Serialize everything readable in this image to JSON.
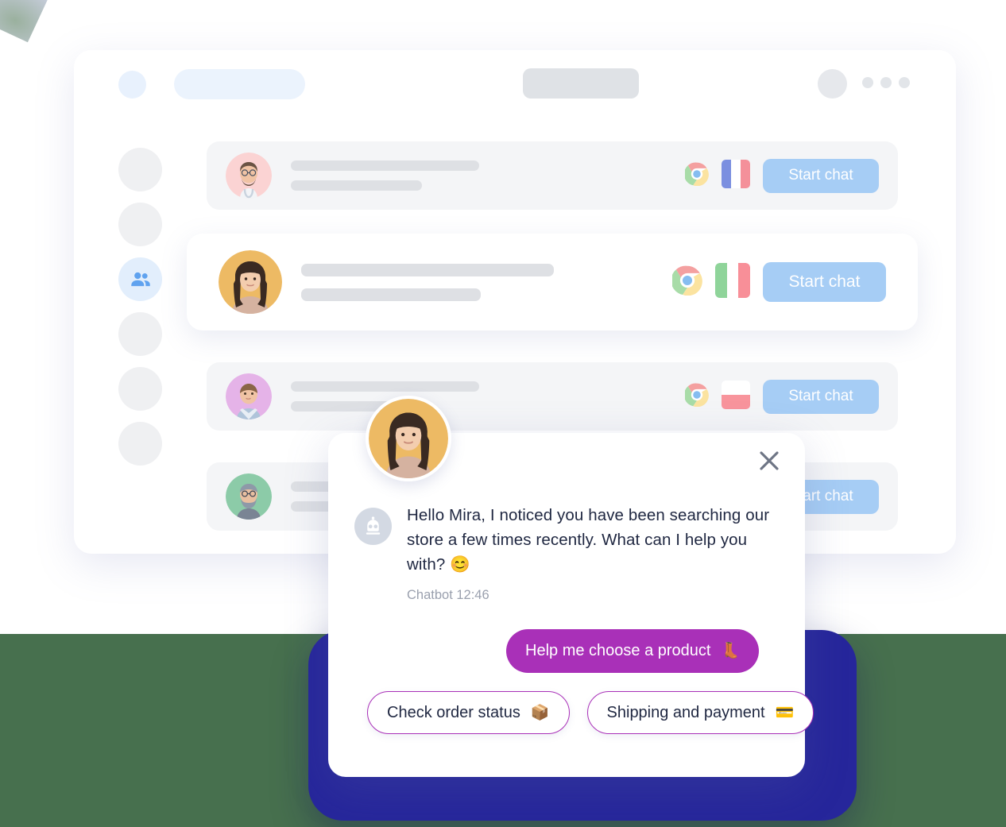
{
  "theme": {
    "accent_blue": "#A6CDF5",
    "accent_purple": "#A930B8",
    "navy_card": "#26269B",
    "green_band": "#47704E",
    "text_dark": "#1F2741",
    "text_muted": "#9AA0AE",
    "sidebar_active": "#E2EEFC",
    "row_bg": "#F4F5F7"
  },
  "header": {
    "avatar_name": "user-avatar-placeholder",
    "menu_icon": "more-dots-icon",
    "placeholders": [
      "logo-placeholder",
      "search-placeholder",
      "title-placeholder"
    ]
  },
  "sidebar": {
    "items": [
      {
        "icon": "placeholder-icon",
        "active": false
      },
      {
        "icon": "placeholder-icon",
        "active": false
      },
      {
        "icon": "people-icon",
        "active": true
      },
      {
        "icon": "placeholder-icon",
        "active": false
      },
      {
        "icon": "placeholder-icon",
        "active": false
      },
      {
        "icon": "placeholder-icon",
        "active": false
      }
    ]
  },
  "visitor_list": {
    "start_chat_label": "Start chat",
    "rows": [
      {
        "avatar": "doctor-avatar",
        "browser": "chrome-icon",
        "flag": "france-flag",
        "flag_name": "France",
        "featured": false
      },
      {
        "avatar": "woman-avatar",
        "browser": "chrome-icon",
        "flag": "italy-flag",
        "flag_name": "Italy",
        "featured": true
      },
      {
        "avatar": "man-avatar",
        "browser": "chrome-icon",
        "flag": "poland-flag",
        "flag_name": "Poland",
        "featured": false
      },
      {
        "avatar": "bearded-man-avatar",
        "browser": "chrome-icon",
        "flag": "hidden-flag",
        "flag_name": "",
        "featured": false
      }
    ]
  },
  "chat_widget": {
    "agent_avatar": "agent-avatar",
    "close_label": "close-icon",
    "bot_icon": "robot-icon",
    "message": "Hello Mira, I noticed you have been searching our store a few times recently. What can I help you with? 😊",
    "message_author": "Chatbot",
    "message_time": "12:46",
    "message_meta": "Chatbot 12:46",
    "quick_replies": {
      "primary": {
        "label": "Help me choose a product",
        "emoji": "👢"
      },
      "secondary": [
        {
          "label": "Check order status",
          "emoji": "📦"
        },
        {
          "label": "Shipping and payment",
          "emoji": "💳"
        }
      ]
    }
  }
}
